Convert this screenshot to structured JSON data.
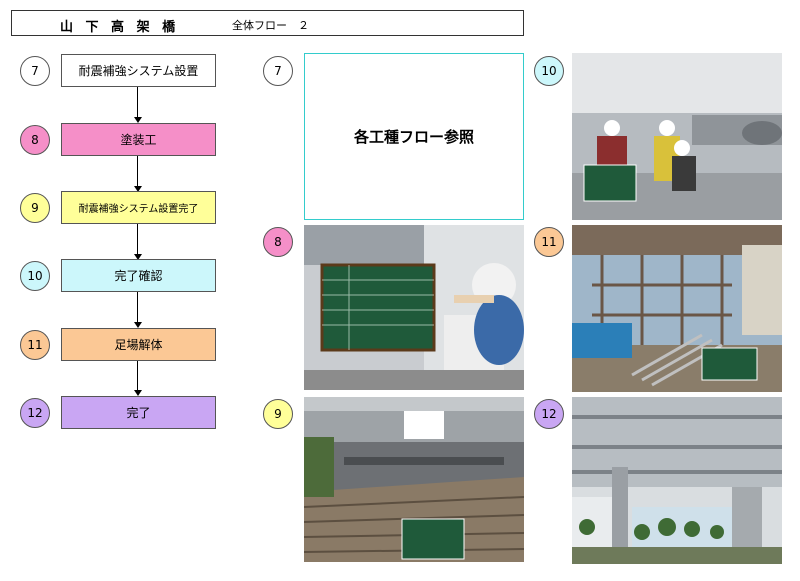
{
  "header": {
    "title": "山 下 高 架 橋",
    "subtitle": "全体フロー　２"
  },
  "colors": {
    "step7": "#ffffff",
    "step8": "#f58fc8",
    "step9": "#ffff99",
    "step10": "#ccf7fb",
    "step11": "#fbc895",
    "step12": "#c9a6f3"
  },
  "flow": [
    {
      "num": "7",
      "label": "耐震補強システム設置"
    },
    {
      "num": "8",
      "label": "塗装工"
    },
    {
      "num": "9",
      "label": "耐震補強システム設置完了"
    },
    {
      "num": "10",
      "label": "完了確認"
    },
    {
      "num": "11",
      "label": "足場解体"
    },
    {
      "num": "12",
      "label": "完了"
    }
  ],
  "photos": {
    "p7": {
      "num": "7",
      "text": "各工種フロー参照"
    },
    "p8": {
      "num": "8"
    },
    "p9": {
      "num": "9"
    },
    "p10": {
      "num": "10"
    },
    "p11": {
      "num": "11"
    },
    "p12": {
      "num": "12"
    }
  }
}
